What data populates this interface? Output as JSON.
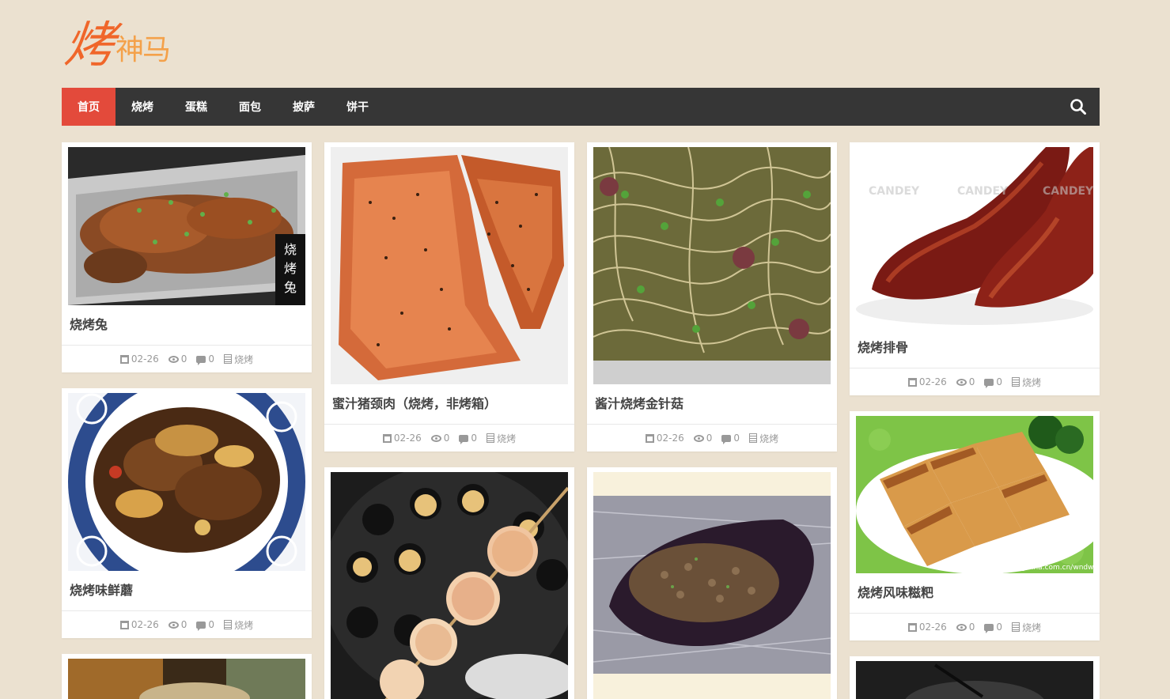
{
  "site": {
    "logo_main": "烤",
    "logo_sub": "神马"
  },
  "nav": {
    "items": [
      {
        "label": "首页",
        "active": true
      },
      {
        "label": "烧烤",
        "active": false
      },
      {
        "label": "蛋糕",
        "active": false
      },
      {
        "label": "面包",
        "active": false
      },
      {
        "label": "披萨",
        "active": false
      },
      {
        "label": "饼干",
        "active": false
      }
    ],
    "search_icon": "search-icon"
  },
  "colors": {
    "background": "#ebe1d0",
    "nav_bg": "#363636",
    "nav_active": "#e34a3b",
    "logo": "#f0662a"
  },
  "posts": [
    {
      "title": "烧烤兔",
      "date": "02-26",
      "views": "0",
      "comments": "0",
      "category": "烧烤"
    },
    {
      "title": "蜜汁猪颈肉（烧烤，非烤箱）",
      "date": "02-26",
      "views": "0",
      "comments": "0",
      "category": "烧烤"
    },
    {
      "title": "酱汁烧烤金针菇",
      "date": "02-26",
      "views": "0",
      "comments": "0",
      "category": "烧烤"
    },
    {
      "title": "烧烤排骨",
      "date": "02-26",
      "views": "0",
      "comments": "0",
      "category": "烧烤"
    },
    {
      "title": "烧烤味鲜蘑",
      "date": "02-26",
      "views": "0",
      "comments": "0",
      "category": "烧烤"
    },
    {
      "title": "烧烤风味糍粑",
      "date": "02-26",
      "views": "0",
      "comments": "0",
      "category": "烧烤"
    }
  ],
  "image_text": {
    "rabbit_caption": "烧烤兔",
    "watermark": "CANDEY",
    "source_credit": "blog.sina.com.cn/wndw"
  }
}
